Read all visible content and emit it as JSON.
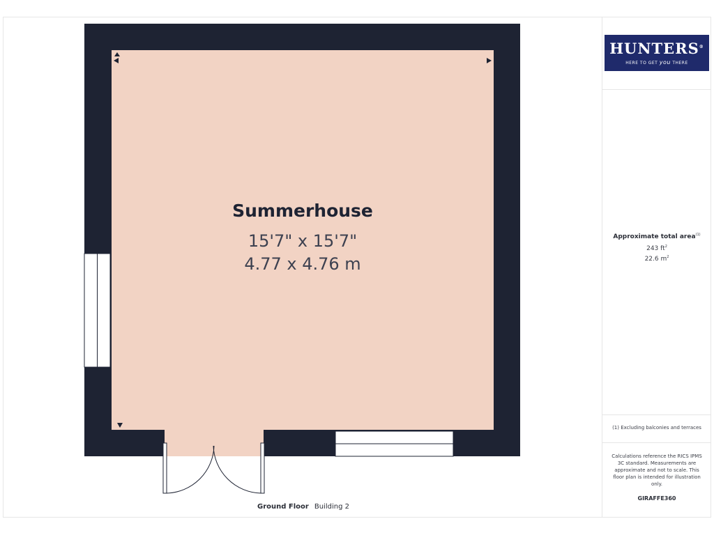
{
  "room": {
    "name": "Summerhouse",
    "dimensions_imperial": "15'7\" x 15'7\"",
    "dimensions_metric": "4.77 x 4.76 m"
  },
  "floor": {
    "label": "Ground Floor",
    "building": "Building 2"
  },
  "brand": {
    "name": "HUNTERS",
    "registered_mark": "®",
    "tagline_before": "HERE TO GET ",
    "tagline_emphasis": "you",
    "tagline_after": " THERE"
  },
  "area": {
    "title": "Approximate total area",
    "title_note": "(1)",
    "sq_ft": "243 ft",
    "sq_ft_unit_sup": "2",
    "sq_m": "22.6 m",
    "sq_m_unit_sup": "2"
  },
  "footnote": "(1) Excluding balconies and terraces",
  "disclaimer": "Calculations reference the RICS IPMS 3C standard. Measurements are approximate and not to scale. This floor plan is intended for illustration only.",
  "credit": "GIRAFFE360",
  "colors": {
    "wall": "#1e2333",
    "floor_fill": "#f2d3c4",
    "brand_blue": "#1f2a6b"
  }
}
